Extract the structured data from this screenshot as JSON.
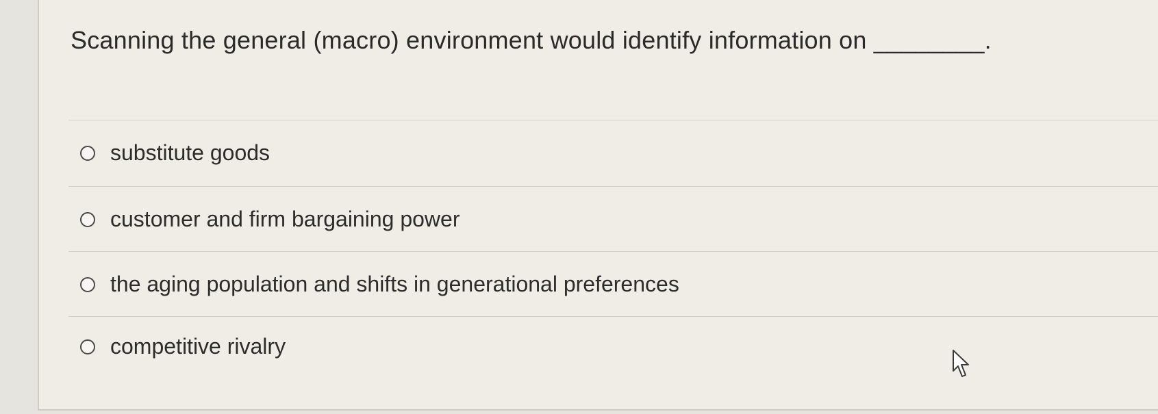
{
  "question": {
    "text": "Scanning the general (macro) environment would identify information on ________."
  },
  "options": [
    {
      "label": "substitute goods",
      "selected": false
    },
    {
      "label": "customer and firm bargaining power",
      "selected": false
    },
    {
      "label": "the aging population and shifts in generational preferences",
      "selected": false
    },
    {
      "label": "competitive rivalry",
      "selected": false
    }
  ],
  "icons": {
    "radio": "radio-button-icon",
    "cursor": "mouse-pointer-icon"
  }
}
